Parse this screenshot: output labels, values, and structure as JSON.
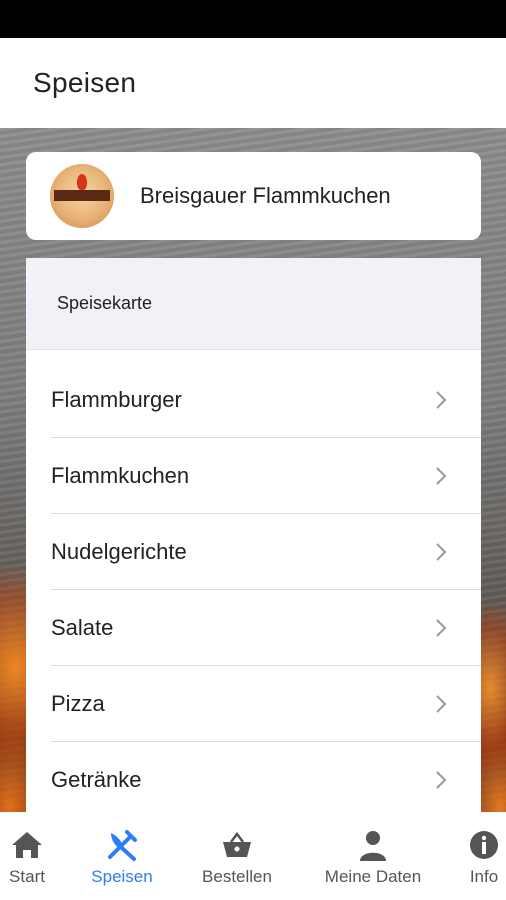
{
  "header": {
    "title": "Speisen"
  },
  "restaurant": {
    "name": "Breisgauer Flammkuchen"
  },
  "menu": {
    "title": "Speisekarte",
    "items": [
      {
        "label": "Flammburger"
      },
      {
        "label": "Flammkuchen"
      },
      {
        "label": "Nudelgerichte"
      },
      {
        "label": "Salate"
      },
      {
        "label": "Pizza"
      },
      {
        "label": "Getränke"
      }
    ]
  },
  "nav": {
    "items": [
      {
        "label": "Start",
        "icon": "home-icon"
      },
      {
        "label": "Speisen",
        "icon": "fork-knife-icon",
        "active": true
      },
      {
        "label": "Bestellen",
        "icon": "basket-icon"
      },
      {
        "label": "Meine Daten",
        "icon": "person-icon"
      },
      {
        "label": "Info",
        "icon": "info-icon"
      }
    ]
  },
  "colors": {
    "accent": "#2f7cf6",
    "text": "#222222",
    "menu_header_bg": "#f0f2f7"
  }
}
